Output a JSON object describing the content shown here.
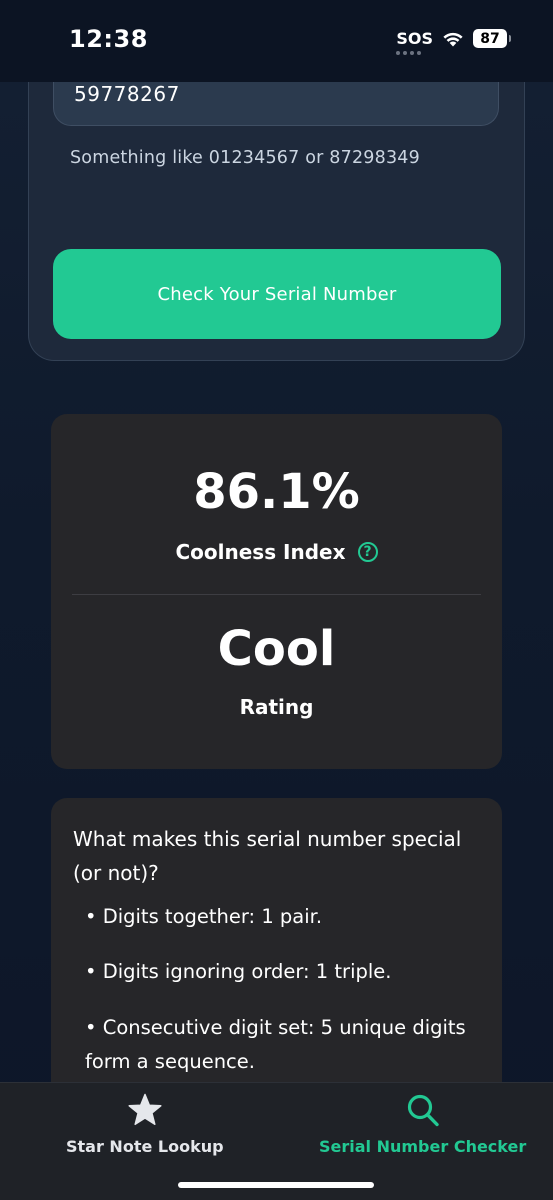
{
  "status_bar": {
    "time": "12:38",
    "sos": "SOS",
    "battery": "87"
  },
  "form": {
    "serial_value": "59778267",
    "hint": "Something like 01234567 or 87298349",
    "check_button": "Check Your Serial Number",
    "button_color": "#22c993"
  },
  "result": {
    "coolness_value": "86.1%",
    "coolness_fraction": 0.861,
    "coolness_label": "Coolness Index",
    "help_icon_glyph": "?",
    "rating_value": "Cool",
    "rating_label": "Rating"
  },
  "explanation": {
    "title": "What makes this serial number special (or not)?",
    "bullets": [
      "• Digits together: 1 pair.",
      "• Digits ignoring order: 1 triple.",
      "• Consecutive digit set: 5 unique digits form a sequence."
    ]
  },
  "tabs": [
    {
      "label": "Star Note Lookup",
      "icon": "star-icon",
      "active": false,
      "color": "#e5e7eb"
    },
    {
      "label": "Serial Number Checker",
      "icon": "search-icon",
      "active": true,
      "color": "#22c993"
    }
  ]
}
